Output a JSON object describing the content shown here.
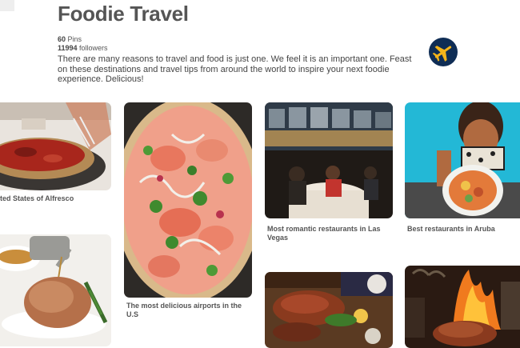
{
  "board": {
    "title": "Foodie Travel",
    "pins_count": "60",
    "pins_label": "Pins",
    "followers_count": "11994",
    "followers_label": "followers",
    "description": "There are many reasons to travel and food is just one. We feel it is an important one. Feast on these destinations and travel tips from around the world to inspire your next foodie experience. Delicious!",
    "logo_icon": "airplane-icon"
  },
  "pins": [
    {
      "caption": "ted States of Alfresco",
      "image": "deep-dish-pizza-photo"
    },
    {
      "caption": "The most delicious airports in the U.S",
      "image": "smoked-salmon-pizza-photo"
    },
    {
      "caption": "Most romantic restaurants in Las Vegas",
      "image": "rooftop-restaurant-photo"
    },
    {
      "caption": "Best restaurants in Aruba",
      "image": "beach-food-photo"
    },
    {
      "caption": "",
      "image": "roast-chicken-photo"
    },
    {
      "caption": "",
      "image": "bbq-platter-photo"
    },
    {
      "caption": "",
      "image": "grilled-meat-fire-photo"
    }
  ],
  "colors": {
    "title": "#555555",
    "logo_bg": "#0f2d55",
    "logo_plane": "#f4b41a"
  }
}
